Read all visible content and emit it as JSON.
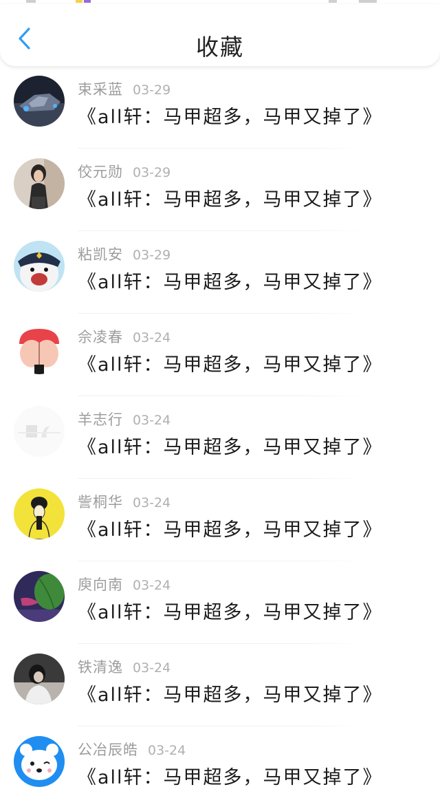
{
  "header": {
    "title": "收藏",
    "back_icon": "chevron-left-icon",
    "accent": "#2f9df5"
  },
  "favorites": [
    {
      "author": "束采蓝",
      "date": "03-29",
      "title": "《all轩：马甲超多，马甲又掉了》",
      "avatar": "spaceship-avatar"
    },
    {
      "author": "佼元勋",
      "date": "03-29",
      "title": "《all轩：马甲超多，马甲又掉了》",
      "avatar": "girl-photo-avatar"
    },
    {
      "author": "粘凯安",
      "date": "03-29",
      "title": "《all轩：马甲超多，马甲又掉了》",
      "avatar": "police-bear-avatar"
    },
    {
      "author": "佘凌春",
      "date": "03-24",
      "title": "《all轩：马甲超多，马甲又掉了》",
      "avatar": "cartoon-butt-avatar"
    },
    {
      "author": "羊志行",
      "date": "03-24",
      "title": "《all轩：马甲超多，马甲又掉了》",
      "avatar": "faded-logo-avatar"
    },
    {
      "author": "訾桐华",
      "date": "03-24",
      "title": "《all轩：马甲超多，马甲又掉了》",
      "avatar": "yellow-sketch-avatar"
    },
    {
      "author": "庾向南",
      "date": "03-24",
      "title": "《all轩：马甲超多，马甲又掉了》",
      "avatar": "purple-leaf-avatar"
    },
    {
      "author": "铁清逸",
      "date": "03-24",
      "title": "《all轩：马甲超多，马甲又掉了》",
      "avatar": "dark-photo-avatar"
    },
    {
      "author": "公冶辰皓",
      "date": "03-24",
      "title": "《all轩：马甲超多，马甲又掉了》",
      "avatar": "blue-bear-avatar"
    }
  ]
}
